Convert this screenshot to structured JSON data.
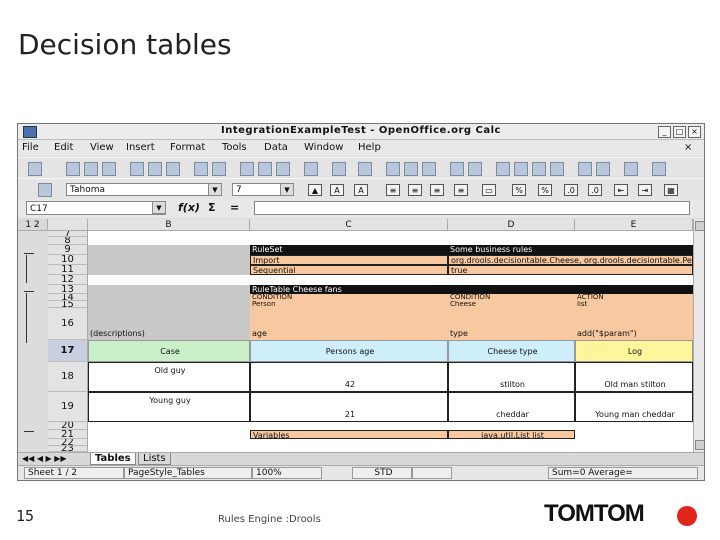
{
  "slide": {
    "title": "Decision tables",
    "page_number": "15",
    "footer_text": "Rules Engine :Drools",
    "logo_text": "TOMTOM",
    "accent_color": "#e1251b"
  },
  "window": {
    "title": "IntegrationExampleTest - OpenOffice.org Calc",
    "buttons": [
      "_",
      "□",
      "×"
    ]
  },
  "menu": [
    "File",
    "Edit",
    "View",
    "Insert",
    "Format",
    "Tools",
    "Data",
    "Window",
    "Help"
  ],
  "toolbar": {
    "font_name": "Tahoma",
    "font_size": "7"
  },
  "formula_bar": {
    "cell_ref": "C17",
    "fx": "f(x)",
    "sum": "Σ",
    "equals": "="
  },
  "columns": [
    "B",
    "C",
    "D",
    "E"
  ],
  "rows": [
    {
      "num": "7"
    },
    {
      "num": "8"
    },
    {
      "num": "9"
    },
    {
      "num": "10"
    },
    {
      "num": "11"
    },
    {
      "num": "12"
    },
    {
      "num": "13"
    },
    {
      "num": "14"
    },
    {
      "num": "15"
    },
    {
      "num": "16"
    },
    {
      "num": "17"
    },
    {
      "num": "18"
    },
    {
      "num": "19"
    },
    {
      "num": "20"
    },
    {
      "num": "21"
    },
    {
      "num": "22"
    },
    {
      "num": "23"
    }
  ],
  "cells": {
    "ruleset_label": "RuleSet",
    "ruleset_value": "Some business rules",
    "import_label": "Import",
    "import_value": "org.drools.decisiontable.Cheese, org.drools.decisiontable.Person",
    "sequential_label": "Sequential",
    "sequential_value": "true",
    "ruletable_label": "RuleTable Cheese fans",
    "cond1": "CONDITION",
    "cond2": "CONDITION",
    "action": "ACTION",
    "person": "Person",
    "cheese": "Cheese",
    "list": "list",
    "descriptions": "(descriptions)",
    "age": "age",
    "type": "type",
    "add": "add(\"$param\")",
    "case_hdr": "Case",
    "persons_age_hdr": "Persons age",
    "cheese_type_hdr": "Cheese type",
    "log_hdr": "Log",
    "case1": "Old guy",
    "age1": "42",
    "type1": "stilton",
    "log1": "Old man stilton",
    "case2": "Young guy",
    "age2": "21",
    "type2": "cheddar",
    "log2": "Young man cheddar",
    "variables_label": "Variables",
    "variables_value": "java.util.List list"
  },
  "sheet_tabs": [
    "Tables",
    "Lists"
  ],
  "status": {
    "sheet": "Sheet 1 / 2",
    "page_style": "PageStyle_Tables",
    "zoom": "100%",
    "mode": "STD",
    "sum": "Sum=0 Average="
  }
}
